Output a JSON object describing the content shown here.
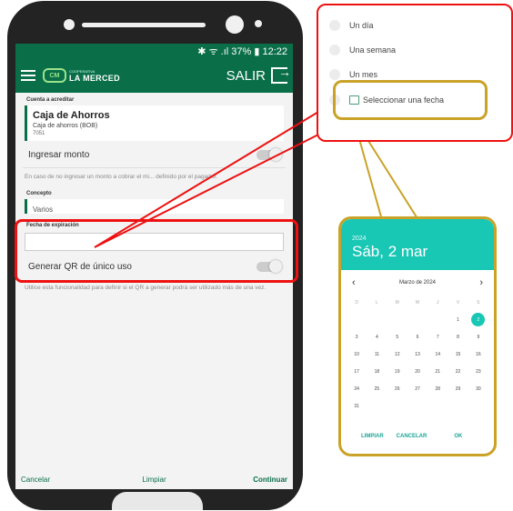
{
  "status_bar": {
    "text": "✱ ᯤ .ıl 37% ▮ 12:22"
  },
  "topbar": {
    "logo_small": "COOPERATIVA",
    "logo_text": "LA MERCED",
    "logo_mark": "CM",
    "exit_label": "SALIR"
  },
  "form": {
    "account_label": "Cuenta a acreditar",
    "account_title": "Caja de Ahorros",
    "account_sub": "Caja de ahorros (BOB)",
    "account_number": "7051",
    "amount_toggle_label": "Ingresar monto",
    "amount_help": "En caso de no ingresar un monto a cobrar el mi... definido por el pagador.",
    "concept_label": "Concepto",
    "concept_value": "Varios",
    "expiration_label": "Fecha de expiración",
    "single_use_label": "Generar QR de único uso",
    "single_use_help": "Utilice esta funcionalidad para definir si el QR a generar podrá ser utilizado más de una vez."
  },
  "bottom_bar": {
    "cancel": "Cancelar",
    "clear": "Limpiar",
    "continue": "Continuar"
  },
  "expiration_options": {
    "items": [
      {
        "label": "Un día"
      },
      {
        "label": "Una semana"
      },
      {
        "label": "Un mes"
      },
      {
        "label": "Seleccionar una fecha"
      }
    ]
  },
  "calendar": {
    "year": "2024",
    "selected_date": "Sáb, 2 mar",
    "month_title": "Marzo de 2024",
    "prev_icon": "‹",
    "next_icon": "›",
    "weekdays": [
      "D",
      "L",
      "M",
      "M",
      "J",
      "V",
      "S"
    ],
    "weeks": [
      [
        "",
        "",
        "",
        "",
        "",
        "1",
        "2"
      ],
      [
        "3",
        "4",
        "5",
        "6",
        "7",
        "8",
        "9"
      ],
      [
        "10",
        "11",
        "12",
        "13",
        "14",
        "15",
        "16"
      ],
      [
        "17",
        "18",
        "19",
        "20",
        "21",
        "22",
        "23"
      ],
      [
        "24",
        "25",
        "26",
        "27",
        "28",
        "29",
        "30"
      ],
      [
        "31",
        "",
        "",
        "",
        "",
        "",
        ""
      ]
    ],
    "selected_day": "2",
    "actions": {
      "clear": "LIMPIAR",
      "cancel": "CANCELAR",
      "ok": "OK"
    }
  },
  "colors": {
    "brand_green": "#0a6f49",
    "teal": "#19c7b5",
    "highlight_red": "#e11111",
    "highlight_gold": "#c9a227"
  }
}
